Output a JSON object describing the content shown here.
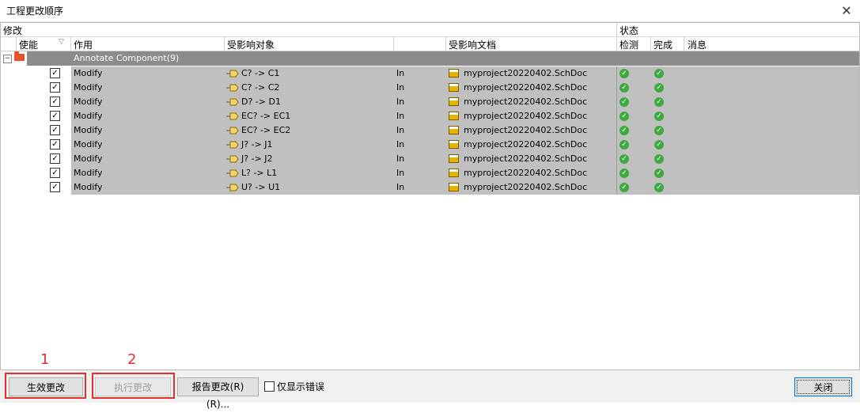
{
  "window": {
    "title": "工程更改顺序"
  },
  "header": {
    "group_modify": "修改",
    "group_status": "状态",
    "col_enable": "使能",
    "col_action": "作用",
    "col_affected_object": "受影响对象",
    "col_affected_doc": "受影响文档",
    "col_check": "检测",
    "col_done": "完成",
    "col_message": "消息"
  },
  "group": {
    "label": "Annotate Component(9)"
  },
  "rows": [
    {
      "action": "Modify",
      "object": "C? -> C1",
      "direction": "In",
      "document": "myproject20220402.SchDoc"
    },
    {
      "action": "Modify",
      "object": "C? -> C2",
      "direction": "In",
      "document": "myproject20220402.SchDoc"
    },
    {
      "action": "Modify",
      "object": "D? -> D1",
      "direction": "In",
      "document": "myproject20220402.SchDoc"
    },
    {
      "action": "Modify",
      "object": "EC? -> EC1",
      "direction": "In",
      "document": "myproject20220402.SchDoc"
    },
    {
      "action": "Modify",
      "object": "EC? -> EC2",
      "direction": "In",
      "document": "myproject20220402.SchDoc"
    },
    {
      "action": "Modify",
      "object": "J? -> J1",
      "direction": "In",
      "document": "myproject20220402.SchDoc"
    },
    {
      "action": "Modify",
      "object": "J? -> J2",
      "direction": "In",
      "document": "myproject20220402.SchDoc"
    },
    {
      "action": "Modify",
      "object": "L? -> L1",
      "direction": "In",
      "document": "myproject20220402.SchDoc"
    },
    {
      "action": "Modify",
      "object": "U? -> U1",
      "direction": "In",
      "document": "myproject20220402.SchDoc"
    }
  ],
  "footer": {
    "apply_label": "生效更改",
    "execute_label": "执行更改",
    "report_label": "报告更改(R) (R)...",
    "only_errors_label": "仅显示错误",
    "close_label": "关闭"
  },
  "annotations": {
    "label1": "1",
    "label2": "2"
  },
  "icons": {
    "close": "close-icon",
    "expander": "minus-box-icon",
    "folder": "folder-icon",
    "component": "component-arrow-icon",
    "document": "schematic-doc-icon",
    "status_ok": "check-circle-icon"
  },
  "colors": {
    "row_bg": "#c0c0c0",
    "group_bar": "#8c8c8c",
    "ok_green": "#3faa3f",
    "annotation_red": "#e03030"
  }
}
